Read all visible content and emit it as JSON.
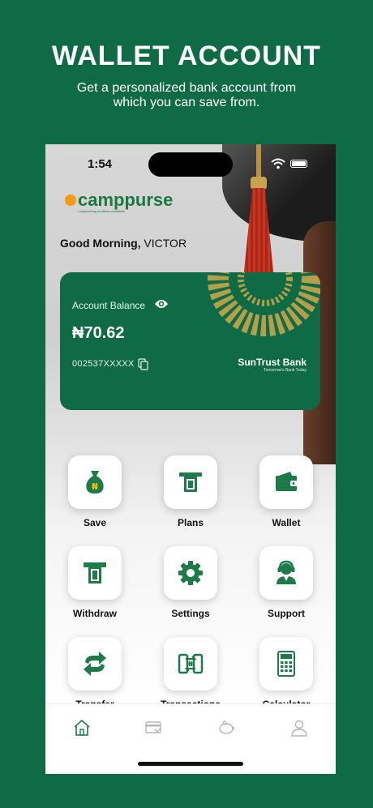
{
  "promo": {
    "title": "WALLET ACCOUNT",
    "subtitle": "Get a personalized bank account from which you can save from."
  },
  "status_bar": {
    "time": "1:54"
  },
  "brand": {
    "name": "camppurse",
    "tagline": "...empowering students worldwide",
    "accent": "#1a7a3e",
    "mark_color": "#f39c12"
  },
  "greeting": {
    "salutation": "Good Morning,",
    "name": "VICTOR"
  },
  "account_card": {
    "balance_label": "Account Balance",
    "balance": "₦70.62",
    "account_number": "002537XXXXX",
    "bank_name": "SunTrust Bank",
    "bank_tagline": "Tomorrow's Bank Today",
    "background": "#0f6b45",
    "ornament_color": "#c7a64a"
  },
  "menu": [
    {
      "label": "Save",
      "icon": "money-bag-icon"
    },
    {
      "label": "Plans",
      "icon": "atm-card-icon"
    },
    {
      "label": "Wallet",
      "icon": "wallet-icon"
    },
    {
      "label": "Withdraw",
      "icon": "withdraw-icon"
    },
    {
      "label": "Settings",
      "icon": "gear-icon"
    },
    {
      "label": "Support",
      "icon": "support-agent-icon"
    },
    {
      "label": "Transfer",
      "icon": "transfer-arrows-icon"
    },
    {
      "label": "Transactions",
      "icon": "transactions-icon"
    },
    {
      "label": "Calculator",
      "icon": "calculator-icon"
    }
  ],
  "tabs": [
    {
      "icon": "home-icon",
      "active": true
    },
    {
      "icon": "card-icon",
      "active": false
    },
    {
      "icon": "piggy-bank-icon",
      "active": false
    },
    {
      "icon": "profile-icon",
      "active": false
    }
  ],
  "colors": {
    "primary": "#0f6b45",
    "icon_green": "#1f7a4a"
  }
}
